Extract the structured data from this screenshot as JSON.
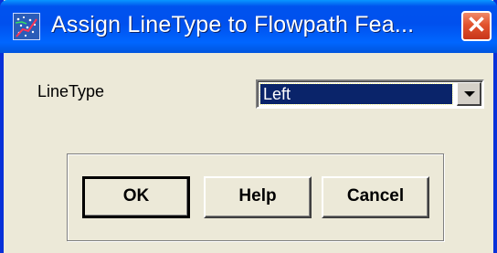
{
  "window": {
    "title": "Assign LineType to Flowpath Fea...",
    "close_symbol": "✕",
    "icon": "map-icon"
  },
  "form": {
    "linetype_label": "LineType",
    "linetype_value": "Left"
  },
  "buttons": {
    "ok_label": "OK",
    "help_label": "Help",
    "cancel_label": "Cancel"
  },
  "colors": {
    "titlebar": "#0053ee",
    "dialog_bg": "#ece9d8",
    "selection": "#0a246a",
    "close_button": "#e2532e"
  }
}
